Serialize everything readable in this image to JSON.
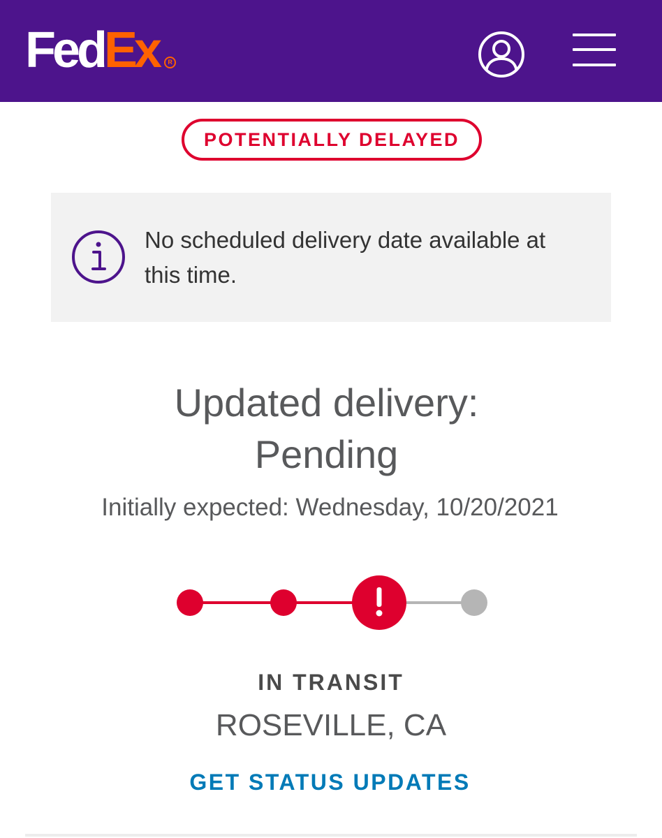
{
  "header": {
    "logo": {
      "fed": "Fed",
      "ex": "Ex",
      "reg": "R"
    },
    "brand_color": "#4d148c",
    "accent_color": "#ff6200",
    "account_icon": "user-icon",
    "menu_icon": "hamburger-menu-icon"
  },
  "status_badge": {
    "label": "POTENTIALLY DELAYED",
    "color": "#de002e"
  },
  "notice": {
    "icon": "info-icon",
    "text": "No scheduled delivery date available at this time."
  },
  "delivery": {
    "updated_line1": "Updated delivery:",
    "updated_line2": "Pending",
    "initially_expected": "Initially expected: Wednesday, 10/20/2021"
  },
  "progress": {
    "completed_steps": 2,
    "current_step": 3,
    "total_steps": 4,
    "current_state": "exception",
    "active_color": "#de002e",
    "inactive_color": "#b5b5b5"
  },
  "shipment": {
    "status": "IN TRANSIT",
    "location": "ROSEVILLE, CA"
  },
  "actions": {
    "get_status_updates": "GET STATUS UPDATES"
  }
}
